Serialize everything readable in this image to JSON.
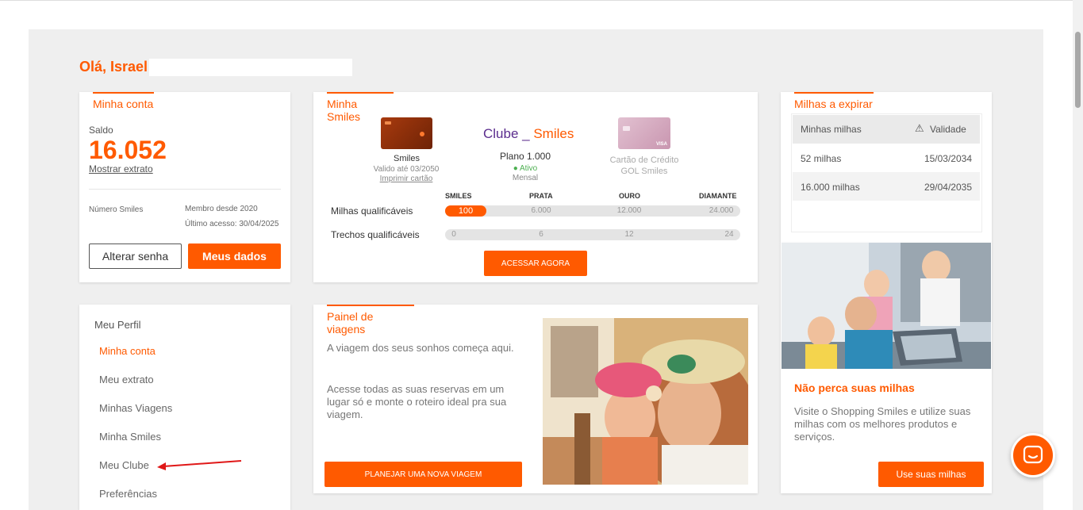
{
  "greeting": "Olá, Israel",
  "account": {
    "title": "Minha conta",
    "balance_label": "Saldo",
    "balance": "16.052",
    "statement_link": "Mostrar extrato",
    "number_label": "Número Smiles",
    "member_since": "Membro desde 2020",
    "last_access": "Último acesso: 30/04/2025",
    "change_password": "Alterar senha",
    "my_data": "Meus dados"
  },
  "smiles": {
    "title": "Minha Smiles",
    "card_name": "Smiles",
    "card_valid": "Valido até 03/2050",
    "print_card": "Imprimir cartão",
    "club_logo_left": "Clube",
    "club_logo_right": "Smiles",
    "plan": "Plano 1.000",
    "plan_status": "Ativo",
    "plan_period": "Mensal",
    "credit_card_line1": "Cartão de Crédito",
    "credit_card_line2": "GOL Smiles",
    "levels": [
      "SMILES",
      "PRATA",
      "OURO",
      "DIAMANTE"
    ],
    "qual_miles_label": "Milhas qualificáveis",
    "qual_miles_value": "100",
    "qual_miles_progress": 0.004,
    "qual_miles_ticks": [
      "6.000",
      "12.000",
      "24.000"
    ],
    "qual_segments_label": "Trechos qualificáveis",
    "qual_segments_ticks": [
      "0",
      "6",
      "12",
      "24"
    ],
    "cta": "ACESSAR AGORA"
  },
  "expiring": {
    "title": "Milhas a expirar",
    "col_miles": "Minhas milhas",
    "col_validity": "Validade",
    "rows": [
      {
        "miles": "52 milhas",
        "date": "15/03/2034"
      },
      {
        "miles": "16.000 milhas",
        "date": "29/04/2035"
      }
    ]
  },
  "profile": {
    "title": "Meu Perfil",
    "items": [
      "Minha conta",
      "Meu extrato",
      "Minhas Viagens",
      "Minha Smiles",
      "Meu Clube",
      "Preferências"
    ]
  },
  "travel": {
    "title": "Painel de viagens",
    "text1": "A viagem dos seus sonhos começa aqui.",
    "text2": "Acesse todas as suas reservas em um lugar só e monte o roteiro ideal pra sua viagem.",
    "cta": "PLANEJAR UMA NOVA VIAGEM"
  },
  "shopping": {
    "title": "Não perca suas milhas",
    "text": "Visite o Shopping Smiles e utilize suas milhas com os melhores produtos e serviços.",
    "cta": "Use suas milhas"
  },
  "colors": {
    "brand": "#ff5a00",
    "club_purple": "#5b2d8e",
    "active_green": "#4caf50"
  }
}
